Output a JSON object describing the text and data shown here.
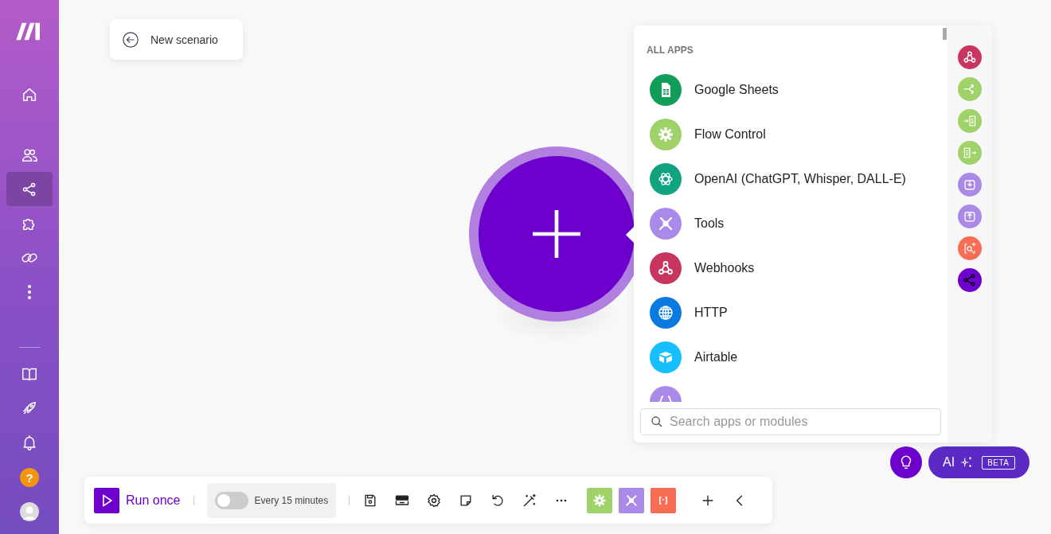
{
  "sidebar": {
    "nav": [
      {
        "kind": "home",
        "selected": false
      },
      {
        "kind": "team",
        "selected": false
      },
      {
        "kind": "scenarios",
        "selected": true
      },
      {
        "kind": "puzzle",
        "selected": false
      },
      {
        "kind": "link",
        "selected": false
      },
      {
        "kind": "more",
        "selected": false
      }
    ],
    "bottom": [
      {
        "kind": "book"
      },
      {
        "kind": "rocket"
      },
      {
        "kind": "bell"
      }
    ],
    "help": "?"
  },
  "back_label": "New scenario",
  "panel": {
    "heading": "ALL APPS",
    "apps": [
      {
        "name": "Google Sheets",
        "color": "#0f9d58",
        "kind": "sheets"
      },
      {
        "name": "Flow Control",
        "color": "#9fd36a",
        "kind": "gear"
      },
      {
        "name": "OpenAI (ChatGPT, Whisper, DALL-E)",
        "color": "#10a37f",
        "kind": "openai"
      },
      {
        "name": "Tools",
        "color": "#a98ae8",
        "kind": "tools"
      },
      {
        "name": "Webhooks",
        "color": "#c8365f",
        "kind": "webhook"
      },
      {
        "name": "HTTP",
        "color": "#0a7ae0",
        "kind": "globe"
      },
      {
        "name": "Airtable",
        "color": "#18bfff",
        "kind": "airtable"
      },
      {
        "color": "#a98ae8",
        "kind": "braces"
      }
    ],
    "search": {
      "placeholder": "Search apps or modules"
    },
    "modules": [
      {
        "color": "#c8365f",
        "kind": "webhook"
      },
      {
        "color": "#9fd36a",
        "kind": "branch"
      },
      {
        "color": "#9fd36a",
        "kind": "iterator"
      },
      {
        "color": "#9fd36a",
        "kind": "aggregator"
      },
      {
        "color": "#a98ae8",
        "kind": "download"
      },
      {
        "color": "#a98ae8",
        "kind": "upload"
      },
      {
        "color": "#f86e54",
        "kind": "searchplus"
      },
      {
        "color": "#6d00cc",
        "kind": "share"
      }
    ]
  },
  "toolbar": {
    "run_label": "Run once",
    "schedule": {
      "on": false,
      "label": "Every 15 minutes"
    },
    "tools": [
      {
        "kind": "save"
      },
      {
        "kind": "template"
      },
      {
        "kind": "settings"
      },
      {
        "kind": "note"
      },
      {
        "kind": "undo"
      },
      {
        "kind": "wand"
      },
      {
        "kind": "dots"
      }
    ],
    "modules": [
      {
        "color": "#9fd36a",
        "kind": "gear"
      },
      {
        "color": "#a98ae8",
        "kind": "tools"
      },
      {
        "color": "#f86e54",
        "kind": "brackets"
      }
    ],
    "end": [
      {
        "kind": "plus"
      },
      {
        "kind": "chevron"
      }
    ]
  },
  "ai": {
    "label": "AI",
    "badge": "BETA"
  }
}
